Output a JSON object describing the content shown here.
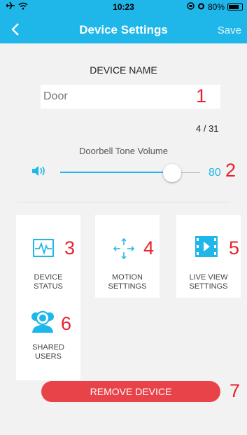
{
  "status_bar": {
    "time": "10:23",
    "battery": "80%",
    "battery_level": 0.8
  },
  "nav": {
    "title": "Device Settings",
    "save_label": "Save"
  },
  "device_name": {
    "title": "DEVICE NAME",
    "placeholder": "Door",
    "count": "4  / 31"
  },
  "volume": {
    "label": "Doorbell Tone Volume",
    "value": "80",
    "level": 0.8
  },
  "tiles": [
    {
      "line1": "DEVICE",
      "line2": "STATUS",
      "icon": "activity-monitor-icon"
    },
    {
      "line1": "MOTION",
      "line2": "SETTINGS",
      "icon": "move-arrows-icon"
    },
    {
      "line1": "LIVE VIEW",
      "line2": "SETTINGS",
      "icon": "video-film-icon"
    },
    {
      "line1": "SHARED",
      "line2": "USERS",
      "icon": "users-icon"
    }
  ],
  "remove_label": "REMOVE DEVICE",
  "markers": [
    "1",
    "2",
    "3",
    "4",
    "5",
    "6",
    "7"
  ],
  "colors": {
    "accent": "#1fb6e9",
    "danger": "#e9434a",
    "marker": "#e8212b",
    "background": "#f2f2f2"
  }
}
